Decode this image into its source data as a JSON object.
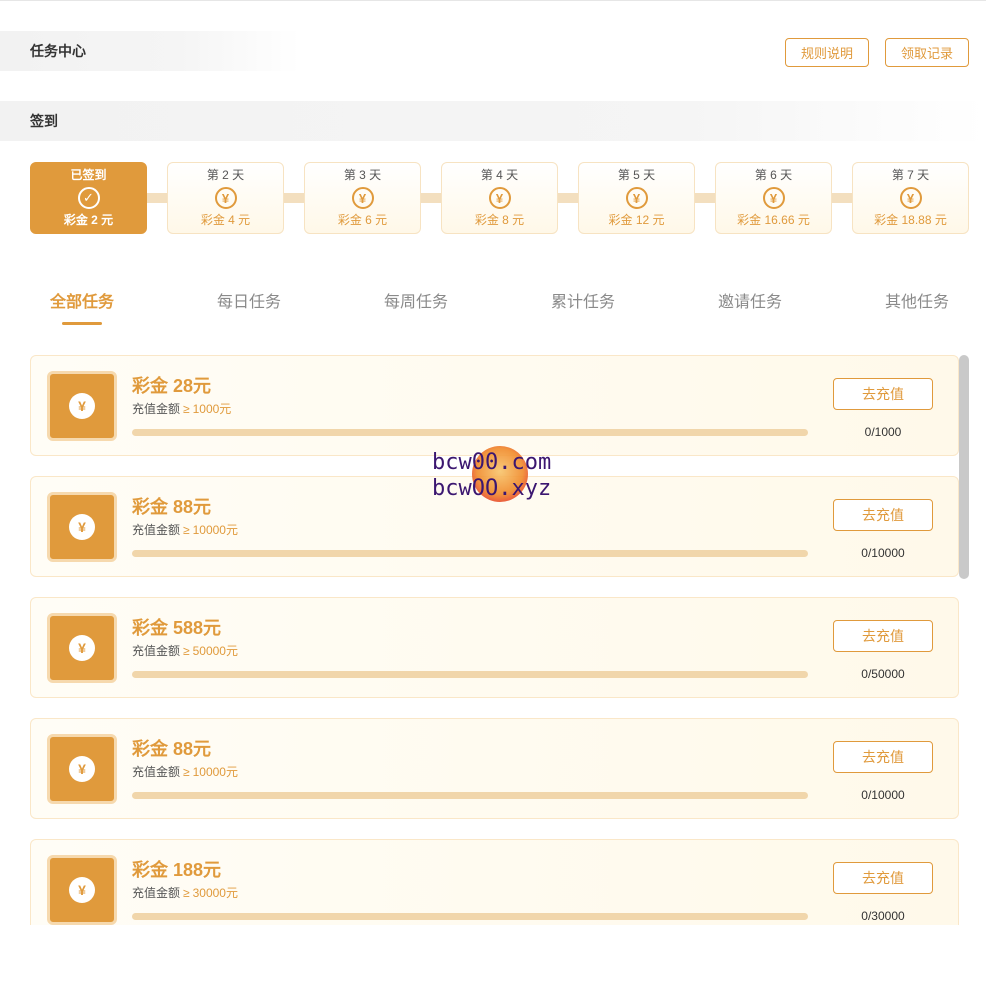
{
  "header": {
    "title": "任务中心",
    "rules_label": "规则说明",
    "records_label": "领取记录"
  },
  "checkin": {
    "section_title": "签到",
    "days": [
      {
        "title": "已签到",
        "reward": "彩金 2 元",
        "done": true
      },
      {
        "title": "第 2 天",
        "reward": "彩金 4 元",
        "done": false
      },
      {
        "title": "第 3 天",
        "reward": "彩金 6 元",
        "done": false
      },
      {
        "title": "第 4 天",
        "reward": "彩金 8 元",
        "done": false
      },
      {
        "title": "第 5 天",
        "reward": "彩金 12 元",
        "done": false
      },
      {
        "title": "第 6 天",
        "reward": "彩金 16.66 元",
        "done": false
      },
      {
        "title": "第 7 天",
        "reward": "彩金 18.88 元",
        "done": false
      }
    ],
    "done_icon": "checkmark-icon",
    "pending_icon": "yen-coin-icon"
  },
  "tabs": [
    {
      "label": "全部任务",
      "active": true
    },
    {
      "label": "每日任务",
      "active": false
    },
    {
      "label": "每周任务",
      "active": false
    },
    {
      "label": "累计任务",
      "active": false
    },
    {
      "label": "邀请任务",
      "active": false
    },
    {
      "label": "其他任务",
      "active": false
    }
  ],
  "tasks": [
    {
      "title": "彩金 28元",
      "req_label": "充值金额",
      "req_symbol": "≥",
      "req_amount": "1000元",
      "button": "去充值",
      "progress_text": "0/1000",
      "progress_fraction": 0
    },
    {
      "title": "彩金 88元",
      "req_label": "充值金额",
      "req_symbol": "≥",
      "req_amount": "10000元",
      "button": "去充值",
      "progress_text": "0/10000",
      "progress_fraction": 0
    },
    {
      "title": "彩金 588元",
      "req_label": "充值金额",
      "req_symbol": "≥",
      "req_amount": "50000元",
      "button": "去充值",
      "progress_text": "0/50000",
      "progress_fraction": 0
    },
    {
      "title": "彩金 88元",
      "req_label": "充值金额",
      "req_symbol": "≥",
      "req_amount": "10000元",
      "button": "去充值",
      "progress_text": "0/10000",
      "progress_fraction": 0
    },
    {
      "title": "彩金 188元",
      "req_label": "充值金额",
      "req_symbol": "≥",
      "req_amount": "30000元",
      "button": "去充值",
      "progress_text": "0/30000",
      "progress_fraction": 0
    }
  ],
  "watermark": {
    "line1": "bcw00.com",
    "line2": "bcwOO.xyz"
  },
  "colors": {
    "accent": "#e09a3c",
    "track": "#f1d6ab",
    "watermark_text": "#3b1670"
  }
}
